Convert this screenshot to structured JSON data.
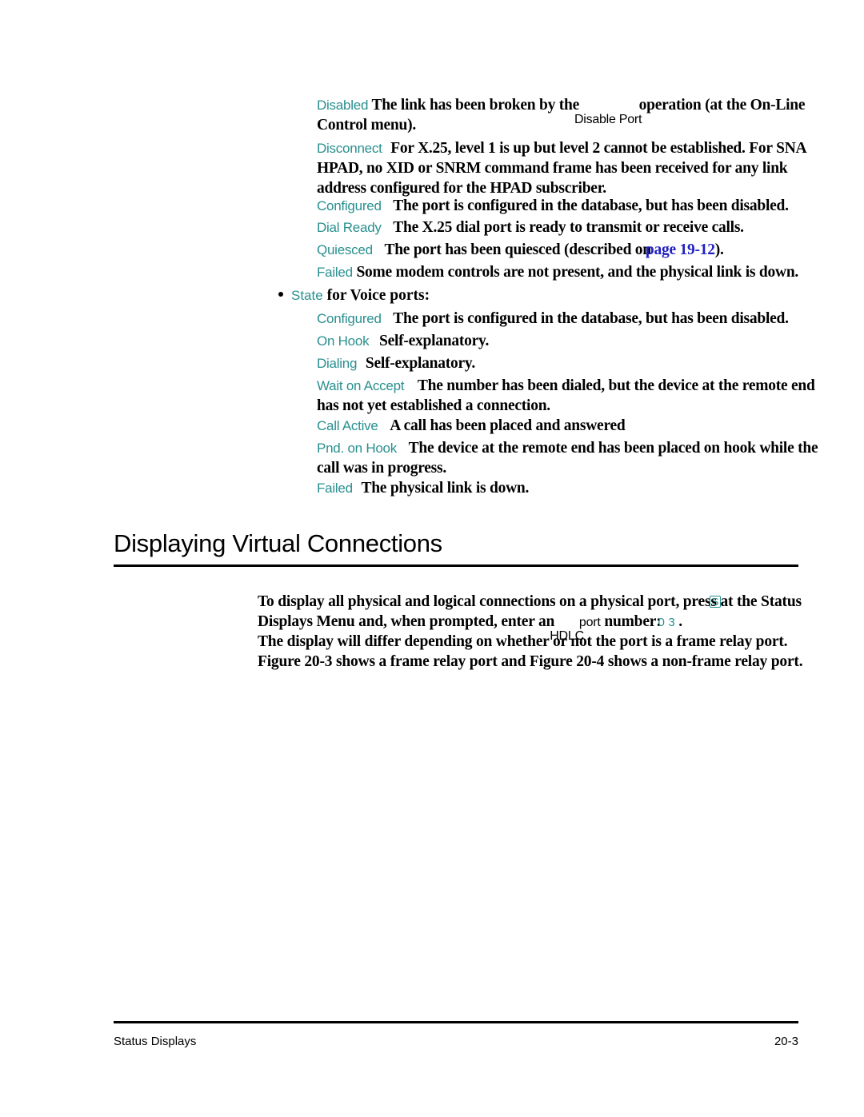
{
  "document": {
    "footer": {
      "left_label": "Status Displays",
      "page_number": "20-3"
    }
  },
  "link_state_definitions": [
    {
      "term": "Disabled",
      "text_before": "The link has been broken by the",
      "inline_ui_label": "Disable Port",
      "text_after": "operation (at the On-Line Control menu)."
    },
    {
      "term": "Disconnect",
      "text": "For X.25, level 1 is up but level 2 cannot be established. For SNA HPAD, no XID or SNRM command frame has been received for any link address configured for the HPAD subscriber."
    },
    {
      "term": "Configured",
      "text": "The port is configured in the database, but has been disabled."
    },
    {
      "term": "Dial Ready",
      "text": "The X.25 dial port is ready to transmit or receive calls."
    },
    {
      "term": "Quiesced",
      "text_before": "The port has been quiesced (described on",
      "link_text": "page 19-12",
      "text_after": ")."
    },
    {
      "term": "Failed",
      "text": "Some modem controls are not present, and the physical link is down."
    }
  ],
  "voice_bullet": {
    "term": "State",
    "label": "for Voice ports:"
  },
  "voice_state_definitions": [
    {
      "term": "Configured",
      "text": "The port is configured in the database, but has been disabled."
    },
    {
      "term": "On Hook",
      "text": "Self-explanatory."
    },
    {
      "term": "Dialing",
      "text": "Self-explanatory."
    },
    {
      "term": "Wait on Accept",
      "text": "The number has been dialed, but the device at the remote end has not yet established a connection."
    },
    {
      "term": "Call Active",
      "text": "A call has been placed and answered"
    },
    {
      "term": "Pnd. on Hook",
      "text": "The device at the remote end has been placed on hook while the call was in progress."
    },
    {
      "term": "Failed",
      "text": "The physical link is down."
    }
  ],
  "section": {
    "heading": "Displaying Virtual Connections",
    "paragraph1": {
      "part1": "To display all physical and logical connections on a physical port, press",
      "key_s": "S",
      "part2": "at the Status Displays Menu and, when prompted, enter an",
      "inline_ui_label": "HDLC",
      "part3": "port",
      "part4": "number:",
      "key_0": "0",
      "key_3": "3",
      "part5": "."
    },
    "paragraph2_line1": "The display will differ depending on whether or not the port is a frame relay port.",
    "paragraph2_line2": "Figure 20-3 shows a frame relay port and Figure 20-4 shows a non-frame relay port."
  },
  "colors": {
    "term_teal": "#2a8f8f",
    "link_blue": "#1f1fc4",
    "text_black": "#000000",
    "page_background": "#ffffff"
  }
}
